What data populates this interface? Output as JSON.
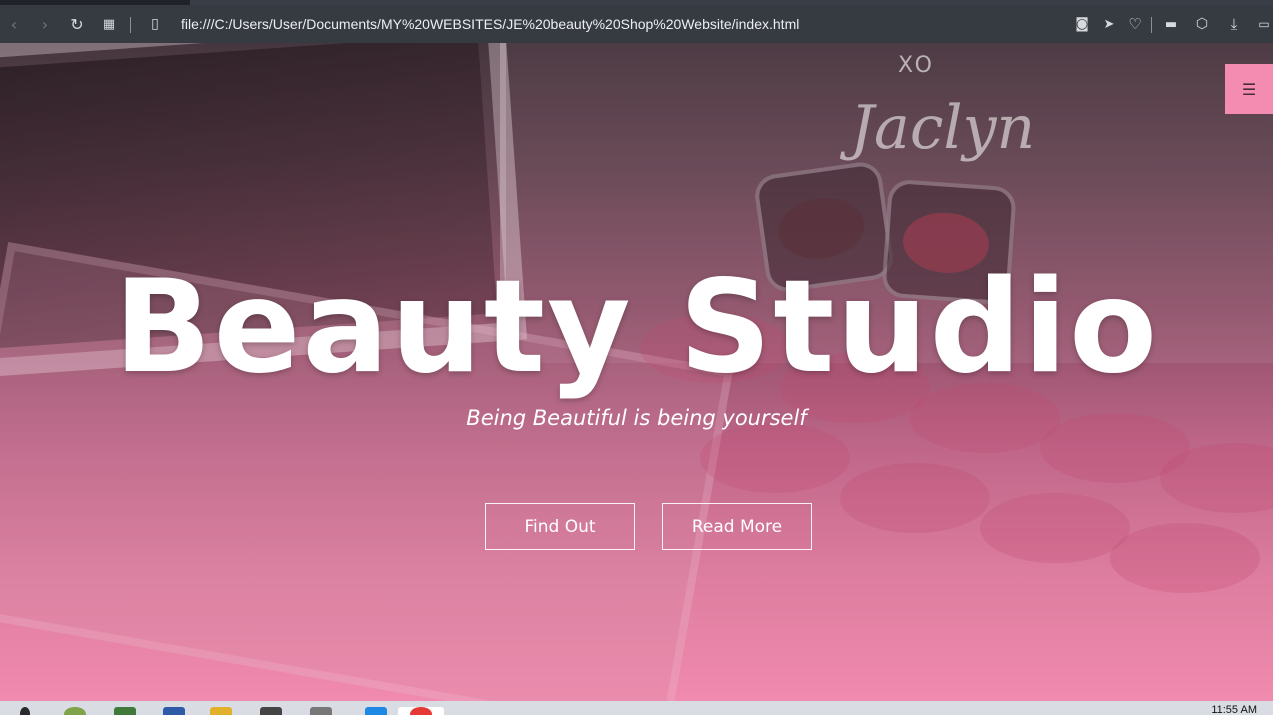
{
  "browser": {
    "url": "file:///C:/Users/User/Documents/MY%20WEBSITES/JE%20beauty%20Shop%20Website/index.html",
    "icons": [
      "back-icon",
      "forward-icon",
      "reload-icon",
      "tabs-grid-icon",
      "page-icon",
      "camera-icon",
      "send-icon",
      "heart-icon",
      "sidebar-icon",
      "cube-icon",
      "download-icon",
      "battery-icon"
    ]
  },
  "hero": {
    "title": "Beauty Studio",
    "subtitle": "Being Beautiful is being yourself",
    "buttons": [
      "Find Out",
      "Read More"
    ],
    "menu_icon": "☰"
  },
  "photo_text": {
    "xo": "XO",
    "script": "Jaclyn"
  },
  "taskbar": {
    "time": "11:55 AM"
  },
  "colors": {
    "accent_pink": "#f48cb1",
    "browser_toolbar": "#363b42"
  }
}
